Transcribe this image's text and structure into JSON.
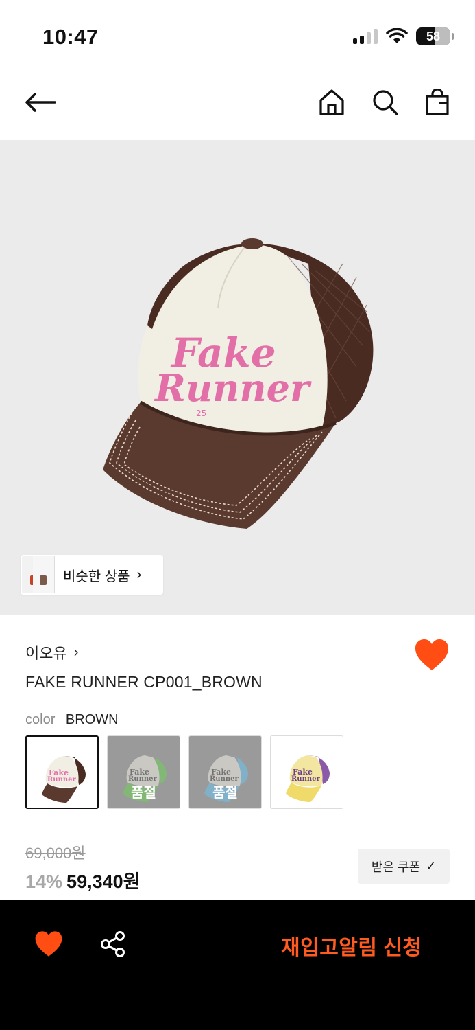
{
  "status_bar": {
    "time": "10:47",
    "battery": "58"
  },
  "header": {
    "back_icon": "arrow-left-icon",
    "home_icon": "home-icon",
    "search_icon": "search-icon",
    "bag_icon": "shopping-bag-icon"
  },
  "hero": {
    "image_subject": "brown trucker cap with pink Fake Runner print",
    "cap_print_line1": "Fake",
    "cap_print_line2": "Runner",
    "cap_print_small": "25",
    "similar_products_label": "비슷한 상품"
  },
  "product": {
    "brand": "이오유",
    "name": "FAKE RUNNER CP001_BROWN",
    "color_label": "color",
    "color_value": "BROWN",
    "options": [
      {
        "color": "brown",
        "selected": true,
        "sold_out": false
      },
      {
        "color": "green",
        "selected": false,
        "sold_out": true,
        "label": "품절"
      },
      {
        "color": "blue",
        "selected": false,
        "sold_out": true,
        "label": "품절"
      },
      {
        "color": "purple",
        "selected": false,
        "sold_out": false
      }
    ],
    "price_original": "69,000원",
    "discount": "14%",
    "price_final": "59,340원",
    "coupon_label": "받은 쿠폰",
    "coupon_check": "✓"
  },
  "bottom_bar": {
    "restock_label": "재입고알림 신청"
  },
  "colors": {
    "accent": "#ff5a1f",
    "heart": "#ff4d14",
    "cap_brown": "#5a3a2f",
    "cap_cream": "#f1efe4",
    "print_pink": "#e36fa8"
  }
}
